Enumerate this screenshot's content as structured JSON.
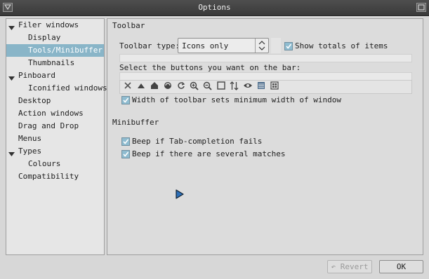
{
  "window": {
    "title": "Options"
  },
  "sidebar": {
    "items": [
      {
        "label": "Filer windows",
        "expanded": true
      },
      {
        "label": "Display"
      },
      {
        "label": "Tools/Minibuffer",
        "selected": true
      },
      {
        "label": "Thumbnails"
      },
      {
        "label": "Pinboard",
        "expanded": true
      },
      {
        "label": "Iconified windows"
      },
      {
        "label": "Desktop"
      },
      {
        "label": "Action windows"
      },
      {
        "label": "Drag and Drop"
      },
      {
        "label": "Menus"
      },
      {
        "label": "Types",
        "expanded": true
      },
      {
        "label": "Colours"
      },
      {
        "label": "Compatibility"
      }
    ]
  },
  "toolbar": {
    "section_title": "Toolbar",
    "type_label": "Toolbar type:",
    "type_value": "Icons only",
    "show_totals_label": "Show totals of items",
    "show_totals_checked": true,
    "select_buttons_label": "Select the buttons you want on the bar:",
    "buttons": [
      "close-icon",
      "up-icon",
      "home-icon",
      "bookmarks-icon",
      "refresh-icon",
      "zoom-in-icon",
      "zoom-out-icon",
      "fit-icon",
      "sort-icon",
      "show-hidden-icon",
      "details-icon",
      "select-icon"
    ],
    "width_sets_min_label": "Width of toolbar sets minimum width of window",
    "width_sets_min_checked": true
  },
  "minibuffer": {
    "section_title": "Minibuffer",
    "beep_tab_label": "Beep if Tab-completion fails",
    "beep_tab_checked": true,
    "beep_several_label": "Beep if there are several matches",
    "beep_several_checked": true
  },
  "footer": {
    "revert_label": "Revert",
    "ok_label": "OK"
  },
  "colors": {
    "selection": "#89b5c8",
    "titlebar": "#444444",
    "checkbox": "#8fbcd0"
  }
}
